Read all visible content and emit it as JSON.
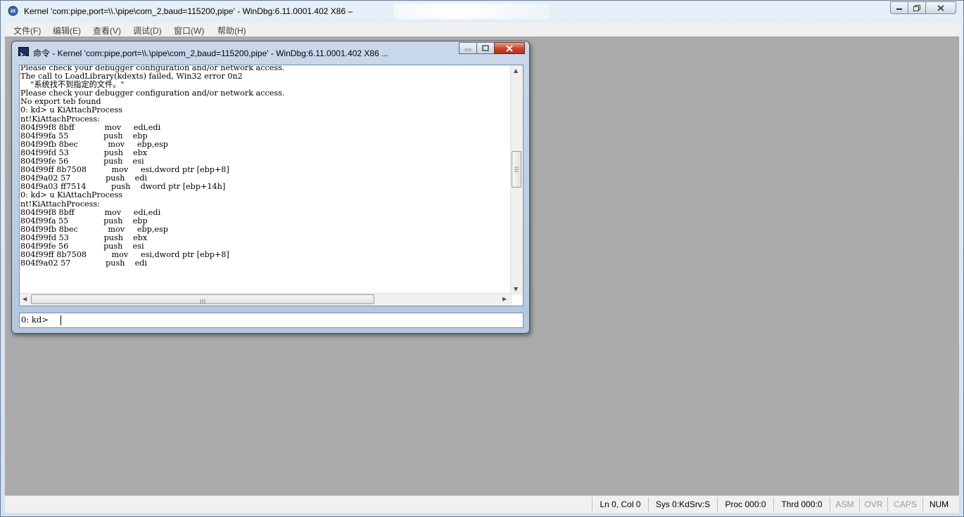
{
  "window": {
    "title": "Kernel 'com:pipe,port=\\\\.\\pipe\\com_2,baud=115200,pipe' - WinDbg:6.11.0001.402 X86 –"
  },
  "menu": [
    "文件(F)",
    "编辑(E)",
    "查看(V)",
    "调试(D)",
    "窗口(W)",
    "帮助(H)"
  ],
  "command_window": {
    "title": "命令 - Kernel 'com:pipe,port=\\\\.\\pipe\\com_2,baud=115200,pipe' - WinDbg:6.11.0001.402 X86 ...",
    "output_lines": [
      "Please check your debugger configuration and/or network access.",
      "The call to LoadLibrary(kdexts) failed, Win32 error 0n2",
      "    \"系统找不到指定的文件。\"",
      "Please check your debugger configuration and/or network access.",
      "No export teb found",
      "0: kd> u KiAttachProcess",
      "nt!KiAttachProcess:",
      "804f99f8 8bff            mov     edi,edi",
      "804f99fa 55              push    ebp",
      "804f99fb 8bec            mov     ebp,esp",
      "804f99fd 53              push    ebx",
      "804f99fe 56              push    esi",
      "804f99ff 8b7508          mov     esi,dword ptr [ebp+8]",
      "804f9a02 57              push    edi",
      "804f9a03 ff7514          push    dword ptr [ebp+14h]",
      "0: kd> u KiAttachProcess",
      "nt!KiAttachProcess:",
      "804f99f8 8bff            mov     edi,edi",
      "804f99fa 55              push    ebp",
      "804f99fb 8bec            mov     ebp,esp",
      "804f99fd 53              push    ebx",
      "804f99fe 56              push    esi",
      "804f99ff 8b7508          mov     esi,dword ptr [ebp+8]",
      "804f9a02 57              push    edi"
    ],
    "prompt": "0: kd>",
    "input_value": ""
  },
  "statusbar": {
    "position": "Ln 0, Col 0",
    "sys": "Sys 0:KdSrv:S",
    "proc": "Proc 000:0",
    "thrd": "Thrd 000:0",
    "asm": "ASM",
    "ovr": "OVR",
    "caps": "CAPS",
    "num": "NUM"
  }
}
